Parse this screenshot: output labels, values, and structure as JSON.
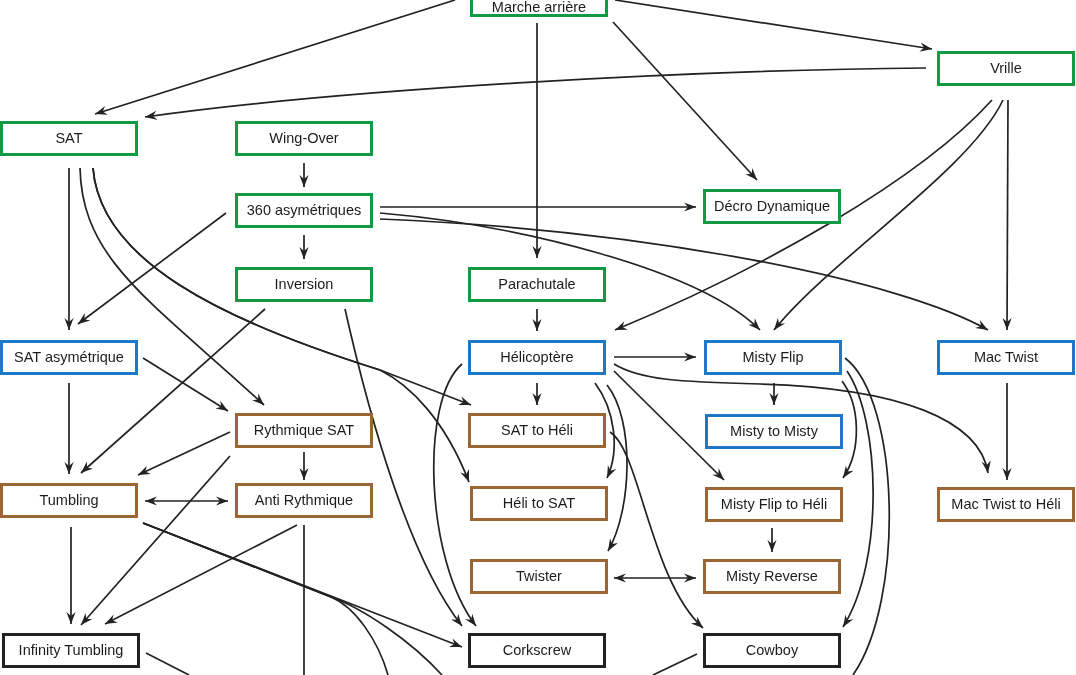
{
  "nodes": [
    {
      "label": "Marche arrière",
      "color": "#129a42",
      "arrows": [
        {
          "kind": "arrow"
        },
        {
          "kind": "arrow"
        },
        {
          "kind": "arrow"
        },
        {
          "kind": "arrow"
        }
      ]
    },
    {
      "label": "Vrille",
      "color": "#129a42",
      "arrows": [
        {
          "kind": "arrow"
        },
        {
          "kind": "arrow"
        },
        {
          "kind": "arrow"
        },
        {
          "kind": "arrow"
        }
      ]
    },
    {
      "label": "SAT",
      "color": "#129a42",
      "arrows": [
        {
          "kind": "arrow"
        },
        {
          "kind": "arrow"
        },
        {
          "kind": "arrow"
        },
        {
          "kind": "arrow"
        }
      ]
    },
    {
      "label": "Wing-Over",
      "color": "#129a42",
      "arrows": [
        {
          "kind": "arrow"
        }
      ]
    },
    {
      "label": "360 asymétriques",
      "color": "#129a42",
      "arrows": [
        {
          "kind": "arrow"
        },
        {
          "kind": "arrow"
        },
        {
          "kind": "arrow"
        },
        {
          "kind": "arrow"
        },
        {
          "kind": "arrow"
        }
      ]
    },
    {
      "label": "Décro Dynamique",
      "color": "#129a42"
    },
    {
      "label": "Inversion",
      "color": "#129a42",
      "arrows": [
        {
          "kind": "arrow"
        },
        {
          "kind": "arrow"
        }
      ]
    },
    {
      "label": "Parachutale",
      "color": "#129a42",
      "arrows": [
        {
          "kind": "arrow"
        }
      ]
    },
    {
      "label": "SAT asymétrique",
      "color": "#1e78c8",
      "arrows": [
        {
          "kind": "arrow"
        },
        {
          "kind": "arrow"
        }
      ]
    },
    {
      "label": "Hélicoptère",
      "color": "#1e78c8",
      "arrows": [
        {
          "kind": "arrow"
        },
        {
          "kind": "arrow"
        },
        {
          "kind": "arrow"
        },
        {
          "kind": "arrow"
        },
        {
          "kind": "arrow"
        },
        {
          "kind": "arrow"
        },
        {
          "kind": "arrow"
        }
      ]
    },
    {
      "label": "Misty Flip",
      "color": "#1e78c8",
      "arrows": [
        {
          "kind": "arrow"
        },
        {
          "kind": "arrow"
        },
        {
          "kind": "arrow"
        },
        {
          "kind": "cut_off"
        }
      ]
    },
    {
      "label": "Mac Twist",
      "color": "#1e78c8",
      "arrows": [
        {
          "kind": "arrow"
        }
      ]
    },
    {
      "label": "Rythmique SAT",
      "color": "#9c6634",
      "arrows": [
        {
          "kind": "arrow"
        },
        {
          "kind": "arrow"
        },
        {
          "kind": "arrow"
        }
      ]
    },
    {
      "label": "SAT to Héli",
      "color": "#9c6634",
      "arrows": [
        {
          "kind": "arrow"
        }
      ]
    },
    {
      "label": "Misty to Misty",
      "color": "#1e78c8"
    },
    {
      "label": "Tumbling",
      "color": "#9c6634",
      "arrows": [
        {
          "kind": "double"
        },
        {
          "kind": "arrow"
        },
        {
          "kind": "arrow"
        },
        {
          "kind": "cut_off"
        },
        {
          "kind": "cut_off"
        }
      ]
    },
    {
      "label": "Anti Rythmique",
      "color": "#9c6634",
      "arrows": [
        {
          "kind": "arrow"
        },
        {
          "kind": "cut_off"
        }
      ]
    },
    {
      "label": "Héli to SAT",
      "color": "#9c6634"
    },
    {
      "label": "Misty Flip to Héli",
      "color": "#9c6634",
      "arrows": [
        {
          "kind": "arrow"
        }
      ]
    },
    {
      "label": "Mac Twist to Héli",
      "color": "#9c6634"
    },
    {
      "label": "Twister",
      "color": "#9c6634",
      "arrows": [
        {
          "kind": "double"
        }
      ]
    },
    {
      "label": "Misty Reverse",
      "color": "#9c6634"
    },
    {
      "label": "Infinity Tumbling",
      "color": "#222222",
      "arrows": [
        {
          "kind": "cut_off"
        }
      ]
    },
    {
      "label": "Corkscrew",
      "color": "#222222"
    },
    {
      "label": "Cowboy",
      "color": "#222222",
      "arrows": [
        {
          "kind": "cut_off"
        }
      ]
    }
  ]
}
